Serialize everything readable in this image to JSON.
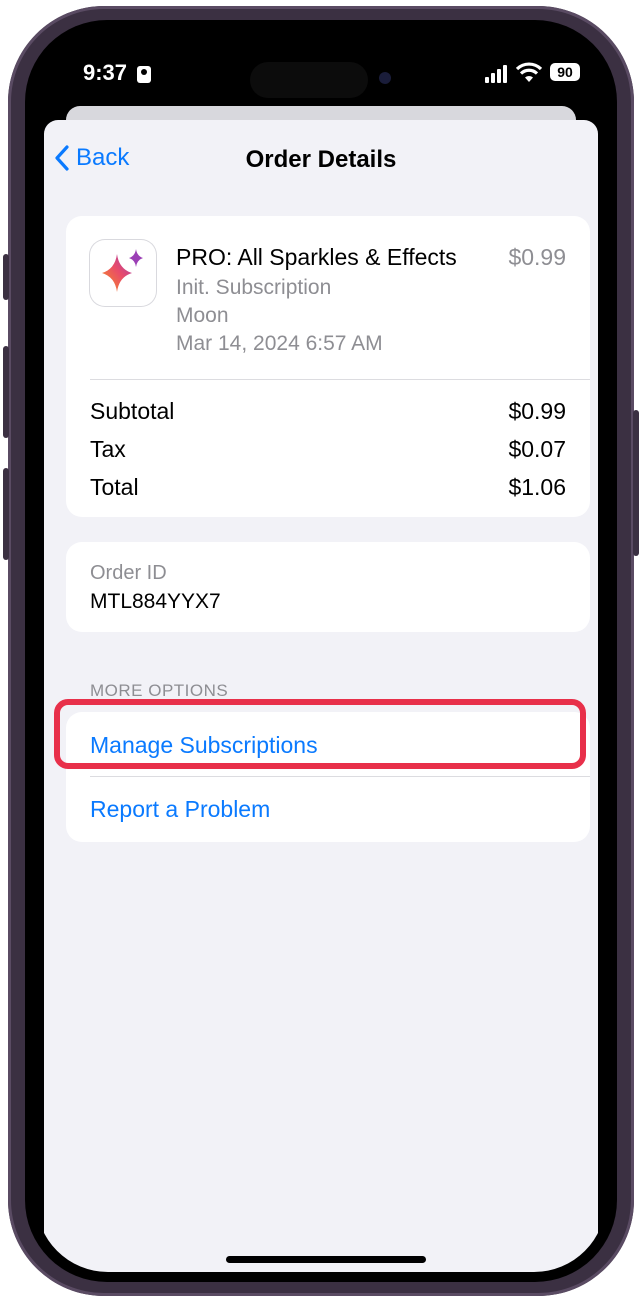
{
  "status_bar": {
    "time": "9:37",
    "battery": "90"
  },
  "nav": {
    "back_label": "Back",
    "title": "Order Details"
  },
  "purchase": {
    "item_name": "PRO: All Sparkles & Effects",
    "price": "$0.99",
    "type": "Init. Subscription",
    "app": "Moon",
    "date": "Mar 14, 2024 6:57 AM",
    "icon": "sparkles-icon"
  },
  "summary": [
    {
      "label": "Subtotal",
      "value": "$0.99"
    },
    {
      "label": "Tax",
      "value": "$0.07"
    },
    {
      "label": "Total",
      "value": "$1.06"
    }
  ],
  "order": {
    "label": "Order ID",
    "value": "MTL884YYX7"
  },
  "more_options": {
    "header": "MORE OPTIONS",
    "items": [
      {
        "label": "Manage Subscriptions"
      },
      {
        "label": "Report a Problem"
      }
    ]
  },
  "colors": {
    "link": "#0a7aff",
    "highlight": "#e8304a",
    "background": "#f2f2f7"
  }
}
